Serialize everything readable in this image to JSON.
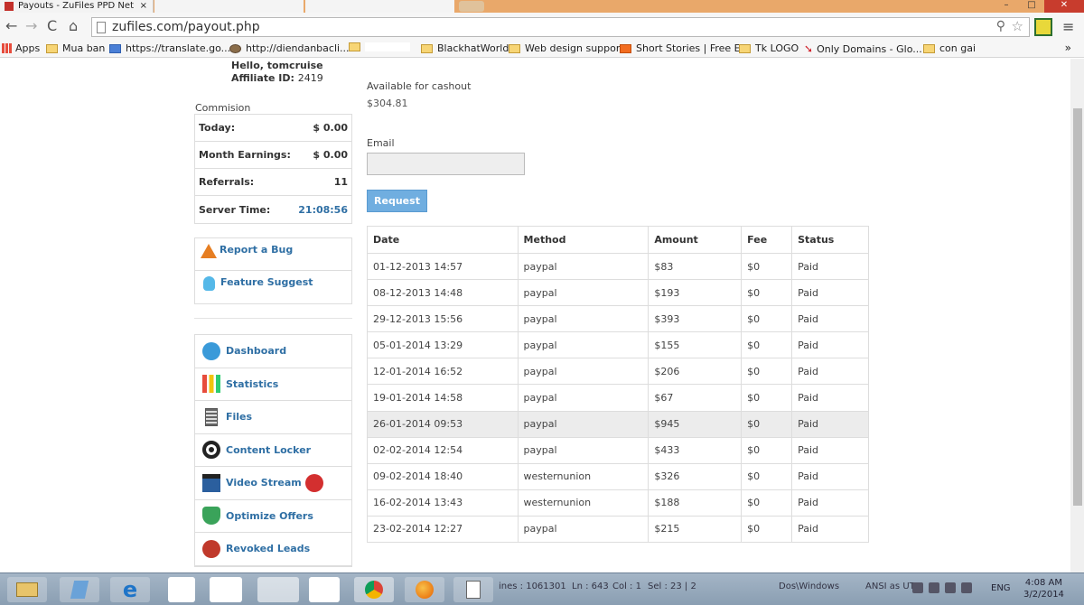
{
  "browser": {
    "tab_title": "Payouts - ZuFiles PPD Net",
    "tab_close": "×",
    "url": "zufiles.com/payout.php",
    "window_buttons": [
      "–",
      "□",
      "✕"
    ]
  },
  "bookmarks": [
    {
      "label": "Apps",
      "icon": "apps-icon"
    },
    {
      "label": "Mua ban",
      "icon": "folder-icon"
    },
    {
      "label": "https://translate.go...",
      "icon": "translate-icon"
    },
    {
      "label": "http://diendanbacli...",
      "icon": "site-icon"
    },
    {
      "label": "BlackhatWorld",
      "icon": "folder-icon"
    },
    {
      "label": "Web design support",
      "icon": "folder-icon"
    },
    {
      "label": "Short Stories | Free E...",
      "icon": "site-icon"
    },
    {
      "label": "Tk LOGO",
      "icon": "folder-icon"
    },
    {
      "label": "Only Domains - Glo...",
      "icon": "site-icon"
    },
    {
      "label": "con gai",
      "icon": "folder-icon"
    }
  ],
  "bookmarks_overflow": "»",
  "user": {
    "greeting": "Hello, tomcruise",
    "affiliate_label": "Affiliate ID:",
    "affiliate_id": "2419"
  },
  "commision": {
    "label": "Commision",
    "rows": [
      {
        "label": "Today:",
        "value": "$ 0.00"
      },
      {
        "label": "Month Earnings:",
        "value": "$ 0.00"
      },
      {
        "label": "Referrals:",
        "value": "11"
      },
      {
        "label": "Server Time:",
        "value": "21:08:56"
      }
    ]
  },
  "support": {
    "report_bug": "Report a Bug",
    "feature_suggest": "Feature Suggest"
  },
  "nav": [
    {
      "label": "Dashboard",
      "icon": "dashboard-icon"
    },
    {
      "label": "Statistics",
      "icon": "statistics-icon"
    },
    {
      "label": "Files",
      "icon": "files-icon"
    },
    {
      "label": "Content Locker",
      "icon": "content-locker-icon"
    },
    {
      "label": "Video Stream",
      "icon": "video-stream-icon"
    },
    {
      "label": "Optimize Offers",
      "icon": "optimize-offers-icon"
    },
    {
      "label": "Revoked Leads",
      "icon": "revoked-leads-icon"
    }
  ],
  "cashout": {
    "label": "Available for cashout",
    "amount": "$304.81",
    "email_label": "Email",
    "email_value": "",
    "request_label": "Request"
  },
  "payouts": {
    "headers": [
      "Date",
      "Method",
      "Amount",
      "Fee",
      "Status"
    ],
    "rows": [
      [
        "01-12-2013 14:57",
        "paypal",
        "$83",
        "$0",
        "Paid"
      ],
      [
        "08-12-2013 14:48",
        "paypal",
        "$193",
        "$0",
        "Paid"
      ],
      [
        "29-12-2013 15:56",
        "paypal",
        "$393",
        "$0",
        "Paid"
      ],
      [
        "05-01-2014 13:29",
        "paypal",
        "$155",
        "$0",
        "Paid"
      ],
      [
        "12-01-2014 16:52",
        "paypal",
        "$206",
        "$0",
        "Paid"
      ],
      [
        "19-01-2014 14:58",
        "paypal",
        "$67",
        "$0",
        "Paid"
      ],
      [
        "26-01-2014 09:53",
        "paypal",
        "$945",
        "$0",
        "Paid"
      ],
      [
        "02-02-2014 12:54",
        "paypal",
        "$433",
        "$0",
        "Paid"
      ],
      [
        "09-02-2014 18:40",
        "westernunion",
        "$326",
        "$0",
        "Paid"
      ],
      [
        "16-02-2014 13:43",
        "westernunion",
        "$188",
        "$0",
        "Paid"
      ],
      [
        "23-02-2014 12:27",
        "paypal",
        "$215",
        "$0",
        "Paid"
      ]
    ]
  },
  "taskbar": {
    "status": {
      "lines": "ines : 1061301",
      "ln": "Ln : 643",
      "col": "Col : 1",
      "sel": "Sel : 23 | 2",
      "eol": "Dos\\Windows",
      "enc": "ANSI as UTF"
    },
    "lang": "ENG",
    "time": "4:08 AM",
    "date": "3/2/2014"
  }
}
